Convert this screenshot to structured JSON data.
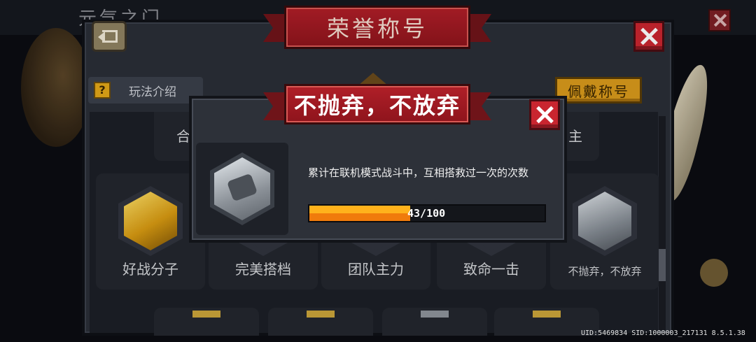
{
  "background": {
    "partial_title": "元气之门"
  },
  "main": {
    "title": "荣誉称号",
    "howto_label": "玩法介绍",
    "howto_icon": "?",
    "wear_label": "佩戴称号",
    "top_row_partial": [
      "合",
      "主"
    ],
    "titles": [
      {
        "name": "好战分子",
        "tier": "gold"
      },
      {
        "name": "完美搭档",
        "tier": "locked"
      },
      {
        "name": "团队主力",
        "tier": "locked"
      },
      {
        "name": "致命一击",
        "tier": "locked"
      },
      {
        "name": "不抛弃，不放弃",
        "tier": "silver"
      }
    ]
  },
  "popup": {
    "title": "不抛弃，不放弃",
    "description": "累计在联机模式战斗中，互相搭救过一次的次数",
    "progress_text": "43/100",
    "progress_current": 43,
    "progress_max": 100
  },
  "footer": {
    "uid_line": "UID:5469834 SID:1000003_217131 8.5.1.38"
  },
  "colors": {
    "ribbon_red": "#a81a22",
    "close_red": "#c9252f",
    "gold_button": "#d89a1c",
    "progress_orange": "#ffb21c"
  }
}
